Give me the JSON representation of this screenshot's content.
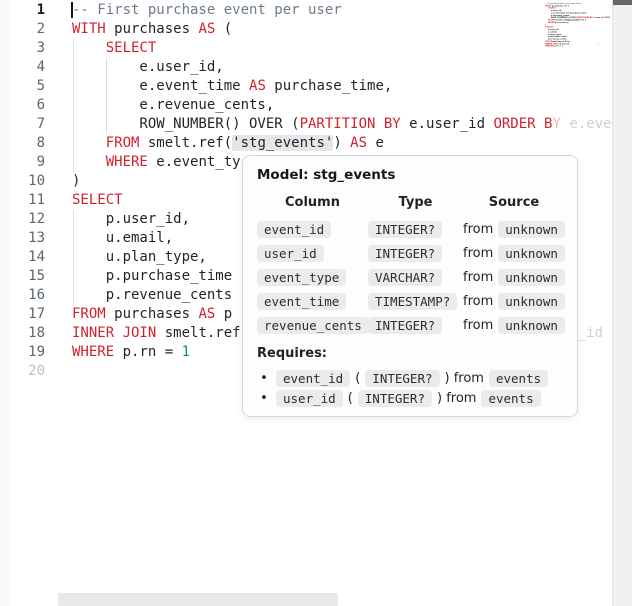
{
  "editor": {
    "lines": [
      {
        "num": "1",
        "active": true,
        "segments": [
          {
            "t": "-- First purchase event per user",
            "c": "com"
          }
        ]
      },
      {
        "num": "2",
        "segments": [
          {
            "t": "WITH",
            "c": "kw"
          },
          {
            "t": " purchases ",
            "c": "def"
          },
          {
            "t": "AS",
            "c": "kw"
          },
          {
            "t": " (",
            "c": "def"
          }
        ]
      },
      {
        "num": "3",
        "guides": [
          0
        ],
        "segments": [
          {
            "t": "    ",
            "c": "def"
          },
          {
            "t": "SELECT",
            "c": "kw"
          }
        ]
      },
      {
        "num": "4",
        "guides": [
          0,
          1
        ],
        "segments": [
          {
            "t": "        e.user_id,",
            "c": "def"
          }
        ]
      },
      {
        "num": "5",
        "guides": [
          0,
          1
        ],
        "segments": [
          {
            "t": "        e.event_time ",
            "c": "def"
          },
          {
            "t": "AS",
            "c": "kw"
          },
          {
            "t": " purchase_time,",
            "c": "def"
          }
        ]
      },
      {
        "num": "6",
        "guides": [
          0,
          1
        ],
        "segments": [
          {
            "t": "        e.revenue_cents,",
            "c": "def"
          }
        ]
      },
      {
        "num": "7",
        "guides": [
          0,
          1
        ],
        "segments": [
          {
            "t": "        ROW_NUMBER() OVER (",
            "c": "def"
          },
          {
            "t": "PARTITION BY",
            "c": "kw"
          },
          {
            "t": " e.user_id ",
            "c": "def"
          },
          {
            "t": "ORDER B",
            "c": "kw"
          },
          {
            "t": "Y",
            "c": "kwfade"
          },
          {
            "t": " ",
            "c": "def"
          },
          {
            "t": "e.even",
            "c": "fade"
          }
        ]
      },
      {
        "num": "8",
        "guides": [
          0
        ],
        "segments": [
          {
            "t": "    ",
            "c": "def"
          },
          {
            "t": "FROM",
            "c": "kw"
          },
          {
            "t": " smelt.ref(",
            "c": "def"
          },
          {
            "t": "'stg_events'",
            "c": "hl"
          },
          {
            "t": ") ",
            "c": "def"
          },
          {
            "t": "AS",
            "c": "kw"
          },
          {
            "t": " e",
            "c": "def"
          }
        ]
      },
      {
        "num": "9",
        "guides": [
          0
        ],
        "segments": [
          {
            "t": "    ",
            "c": "def"
          },
          {
            "t": "WHERE",
            "c": "kw"
          },
          {
            "t": " e.event_ty",
            "c": "def"
          }
        ]
      },
      {
        "num": "10",
        "segments": [
          {
            "t": ")",
            "c": "def"
          }
        ]
      },
      {
        "num": "11",
        "segments": [
          {
            "t": "SELECT",
            "c": "kw"
          }
        ]
      },
      {
        "num": "12",
        "guides": [
          0
        ],
        "segments": [
          {
            "t": "    p.user_id,",
            "c": "def"
          }
        ]
      },
      {
        "num": "13",
        "guides": [
          0
        ],
        "segments": [
          {
            "t": "    u.email,",
            "c": "def"
          }
        ]
      },
      {
        "num": "14",
        "guides": [
          0
        ],
        "segments": [
          {
            "t": "    u.plan_type,",
            "c": "def"
          }
        ]
      },
      {
        "num": "15",
        "guides": [
          0
        ],
        "segments": [
          {
            "t": "    p.purchase_time ",
            "c": "def"
          }
        ]
      },
      {
        "num": "16",
        "guides": [
          0
        ],
        "segments": [
          {
            "t": "    p.revenue_cents ",
            "c": "def"
          }
        ]
      },
      {
        "num": "17",
        "segments": [
          {
            "t": "FROM",
            "c": "kw"
          },
          {
            "t": " purchases ",
            "c": "def"
          },
          {
            "t": "AS",
            "c": "kw"
          },
          {
            "t": " p",
            "c": "def"
          }
        ]
      },
      {
        "num": "18",
        "segments": [
          {
            "t": "INNER JOIN",
            "c": "kw"
          },
          {
            "t": " smelt.ref",
            "c": "def"
          },
          {
            "t": "                                        ",
            "c": "hidden-seg"
          },
          {
            "t": "_id",
            "c": "fade"
          }
        ]
      },
      {
        "num": "19",
        "segments": [
          {
            "t": "WHERE",
            "c": "kw"
          },
          {
            "t": " p.rn = ",
            "c": "def"
          },
          {
            "t": "1",
            "c": "num"
          }
        ]
      },
      {
        "num": "20",
        "dim": true,
        "segments": []
      }
    ]
  },
  "tooltip": {
    "title": "Model: stg_events",
    "headers": [
      "Column",
      "Type",
      "Source"
    ],
    "rows": [
      {
        "column": "event_id",
        "type": "INTEGER?",
        "from_label": "from",
        "source": "unknown"
      },
      {
        "column": "user_id",
        "type": "INTEGER?",
        "from_label": "from",
        "source": "unknown"
      },
      {
        "column": "event_type",
        "type": "VARCHAR?",
        "from_label": "from",
        "source": "unknown"
      },
      {
        "column": "event_time",
        "type": "TIMESTAMP?",
        "from_label": "from",
        "source": "unknown"
      },
      {
        "column": "revenue_cents",
        "type": "INTEGER?",
        "from_label": "from",
        "source": "unknown"
      }
    ],
    "requires_label": "Requires:",
    "requires": [
      {
        "column": "event_id",
        "open": "(",
        "type": "INTEGER?",
        "close": ") from",
        "model": "events"
      },
      {
        "column": "user_id",
        "open": "(",
        "type": "INTEGER?",
        "close": ") from",
        "model": "events"
      }
    ]
  },
  "colors": {
    "keyword": "#cf222e",
    "comment": "#6e7b8b",
    "number": "#0e9177",
    "text": "#1f2328",
    "chip_bg": "#ebebeb",
    "token_highlight": "#e4e6e9"
  }
}
